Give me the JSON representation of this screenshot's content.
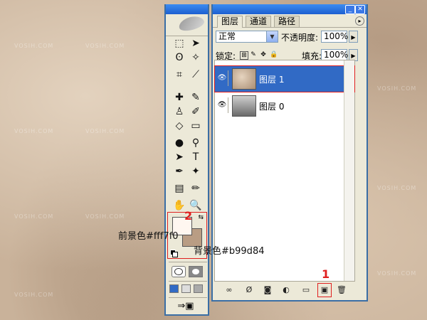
{
  "watermark": "VOSIH.COM",
  "toolbox": {
    "tools": [
      {
        "name": "marquee-tool-icon",
        "glyph": "⬚"
      },
      {
        "name": "move-tool-icon",
        "glyph": "➤"
      },
      {
        "name": "lasso-tool-icon",
        "glyph": "ʘ"
      },
      {
        "name": "magic-wand-icon",
        "glyph": "✧"
      },
      {
        "name": "crop-tool-icon",
        "glyph": "⌗"
      },
      {
        "name": "slice-tool-icon",
        "glyph": "⟋"
      },
      {
        "name": "healing-brush-icon",
        "glyph": "✚"
      },
      {
        "name": "brush-tool-icon",
        "glyph": "✎"
      },
      {
        "name": "stamp-tool-icon",
        "glyph": "♙"
      },
      {
        "name": "history-brush-icon",
        "glyph": "✐"
      },
      {
        "name": "eraser-tool-icon",
        "glyph": "◇"
      },
      {
        "name": "gradient-tool-icon",
        "glyph": "▭"
      },
      {
        "name": "blur-tool-icon",
        "glyph": "●"
      },
      {
        "name": "dodge-tool-icon",
        "glyph": "⚲"
      },
      {
        "name": "path-select-icon",
        "glyph": "➤"
      },
      {
        "name": "type-tool-icon",
        "glyph": "T"
      },
      {
        "name": "pen-tool-icon",
        "glyph": "✒"
      },
      {
        "name": "shape-tool-icon",
        "glyph": "✦"
      },
      {
        "name": "notes-tool-icon",
        "glyph": "▤"
      },
      {
        "name": "eyedropper-icon",
        "glyph": "✏"
      },
      {
        "name": "hand-tool-icon",
        "glyph": "✋"
      },
      {
        "name": "zoom-tool-icon",
        "glyph": "🔍"
      }
    ],
    "foreground_color": "#fff7f0",
    "background_color": "#b99d84"
  },
  "panel": {
    "tabs": [
      "图层",
      "通道",
      "路径"
    ],
    "blend_mode": "正常",
    "opacity_label": "不透明度:",
    "opacity_value": "100%",
    "lock_label": "锁定:",
    "fill_label": "填充:",
    "fill_value": "100%",
    "layers": [
      {
        "name": "图层 1",
        "selected": true
      },
      {
        "name": "图层 0",
        "selected": false
      }
    ]
  },
  "annotations": {
    "marker_1": "1",
    "marker_2": "2",
    "fg_note": "前景色#fff7f0",
    "bg_note": "背景色#b99d84"
  },
  "colors": {
    "accent": "#316ac5",
    "highlight": "#e02020"
  }
}
